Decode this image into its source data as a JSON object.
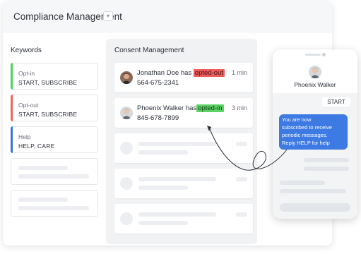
{
  "header": {
    "title": "Compliance Management",
    "dropdown_icon": "chevron-down-icon"
  },
  "keywords": {
    "title": "Keywords",
    "items": [
      {
        "label": "Opt-in",
        "value": "START, SUBSCRIBE",
        "color": "#4cd15c"
      },
      {
        "label": "Opt-out",
        "value": "START, SUBSCRIBE",
        "color": "#f06262"
      },
      {
        "label": "Help",
        "value": "HELP, CARE",
        "color": "#3a73d6"
      }
    ]
  },
  "consent": {
    "title": "Consent Management",
    "messages": [
      {
        "name": "Jonathan Doe",
        "verb": "has",
        "status": "opted-out",
        "phone": "564-675-2341",
        "time": "1 min"
      },
      {
        "name": "Phoenix Walker",
        "verb": "has",
        "status": "opted-in",
        "phone": "845-678-7899",
        "time": "3 min"
      }
    ]
  },
  "phone": {
    "contact_name": "Phoenix Walker",
    "sent_message": "START",
    "reply_lines": [
      "You are now",
      "subscribed to receive",
      "periodic messages.",
      "Reply HELP for help"
    ]
  },
  "colors": {
    "accent_blue": "#3d7ae3",
    "opt_in": "#5ad264",
    "opt_out": "#f05a5a"
  }
}
